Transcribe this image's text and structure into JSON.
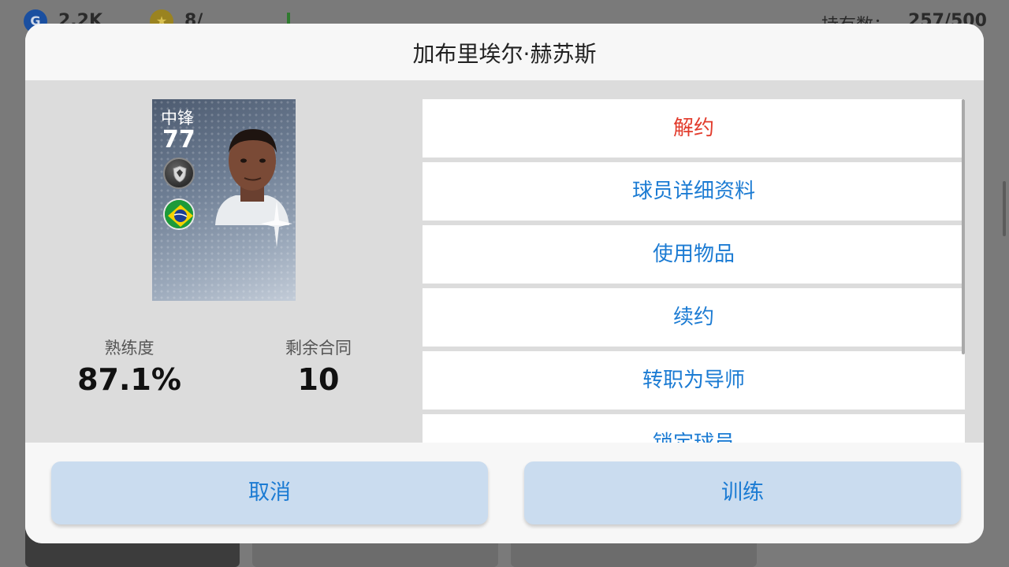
{
  "background": {
    "currency_gp": "2.2K",
    "currency_coins": "8/",
    "holdings_label": "持有数：",
    "holdings_value": "257/500"
  },
  "dialog": {
    "title": "加布里埃尔·赫苏斯"
  },
  "player": {
    "position": "中锋",
    "rating": "77",
    "nationality_flag_icon": "brazil-flag-icon",
    "club_badge_icon": "club-badge-icon"
  },
  "stats": {
    "proficiency_label": "熟练度",
    "proficiency_value": "87.1%",
    "contract_label": "剩余合同",
    "contract_value": "10"
  },
  "menu": {
    "items": [
      {
        "label": "解约",
        "danger": true
      },
      {
        "label": "球员详细资料"
      },
      {
        "label": "使用物品"
      },
      {
        "label": "续约"
      },
      {
        "label": "转职为导师"
      },
      {
        "label": "锁定球员"
      }
    ]
  },
  "footer": {
    "cancel_label": "取消",
    "train_label": "训练"
  },
  "colors": {
    "accent": "#1b7bd3",
    "danger": "#e23b2c",
    "button_bg": "#cadcef"
  }
}
